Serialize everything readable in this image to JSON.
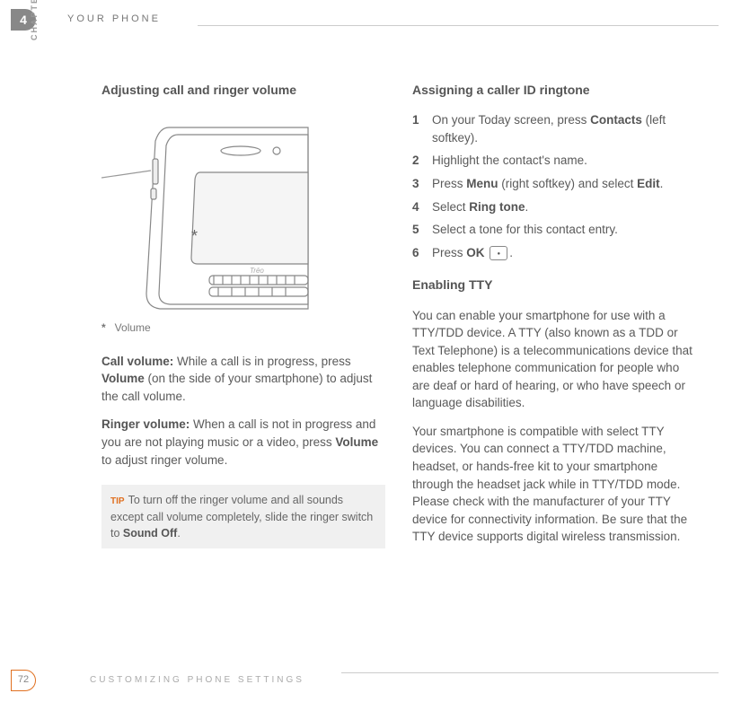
{
  "header": {
    "chapter_number": "4",
    "title": "YOUR PHONE",
    "side_label": "CHAPTER"
  },
  "left_column": {
    "section_title": "Adjusting call and ringer volume",
    "callout_mark": "*",
    "caption_mark": "*",
    "caption_text": "Volume",
    "call_volume_label": "Call volume:",
    "call_volume_text_1": " While a call is in progress, press ",
    "call_volume_bold": "Volume",
    "call_volume_text_2": " (on the side of your smartphone) to adjust the call volume.",
    "ringer_volume_label": "Ringer volume:",
    "ringer_volume_text_1": " When a call is not in progress and you are not playing music or a video, press ",
    "ringer_volume_bold": "Volume",
    "ringer_volume_text_2": " to adjust ringer volume.",
    "tip_label": "TIP",
    "tip_text_1": "To turn off the ringer volume and all sounds except call volume completely, slide the ringer switch to ",
    "tip_bold": "Sound Off",
    "tip_text_2": "."
  },
  "right_column": {
    "section_a_title": "Assigning a caller ID ringtone",
    "steps_a": [
      {
        "num": "1",
        "pre": "On your Today screen, press ",
        "bold": "Contacts",
        "post": " (left softkey)."
      },
      {
        "num": "2",
        "pre": "Highlight the contact's name.",
        "bold": "",
        "post": ""
      },
      {
        "num": "3",
        "pre": "Press ",
        "bold": "Menu",
        "post": " (right softkey) and select ",
        "bold2": "Edit",
        "post2": "."
      },
      {
        "num": "4",
        "pre": "Select ",
        "bold": "Ring tone",
        "post": "."
      },
      {
        "num": "5",
        "pre": "Select a tone for this contact entry.",
        "bold": "",
        "post": ""
      },
      {
        "num": "6",
        "pre": "Press ",
        "bold": "OK",
        "post": " ",
        "icon": true,
        "post2": "."
      }
    ],
    "section_b_title": "Enabling TTY",
    "tty_para1": "You can enable your smartphone for use with a TTY/TDD device. A TTY (also known as a TDD or Text Telephone) is a telecommunications device that enables telephone communication for people who are deaf or hard of hearing, or who have speech or language disabilities.",
    "tty_para2": "Your smartphone is compatible with select TTY devices. You can connect a TTY/TDD machine, headset, or hands-free kit to your smartphone through the headset jack while in TTY/TDD mode. Please check with the manufacturer of your TTY device for connectivity information. Be sure that the TTY device supports digital wireless transmission."
  },
  "footer": {
    "page_number": "72",
    "text": "CUSTOMIZING PHONE SETTINGS"
  },
  "phone_label": "Trēo"
}
